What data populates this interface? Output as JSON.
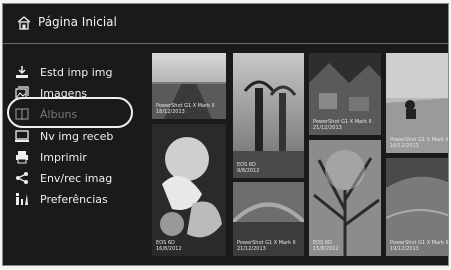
{
  "header": {
    "title": "Página Inicial",
    "icon": "home-icon"
  },
  "menu": {
    "items": [
      {
        "label": "Estd imp img",
        "icon": "download-to-printer-icon"
      },
      {
        "label": "Imagens",
        "icon": "images-icon"
      },
      {
        "label": "Álbuns",
        "icon": "album-icon",
        "selected": true
      },
      {
        "label": "Nv img receb",
        "icon": "new-images-received-icon"
      },
      {
        "label": "Imprimir",
        "icon": "printer-icon"
      },
      {
        "label": "Env/rec imag",
        "icon": "share-icon"
      },
      {
        "label": "Preferências",
        "icon": "preferences-icon"
      }
    ]
  },
  "thumbnails": [
    {
      "camera": "PowerShot G1 X Mark II",
      "date": "18/12/2013"
    },
    {
      "camera": "EOS 6D",
      "date": "9/8/2012"
    },
    {
      "camera": "PowerShot G1 X Mark II",
      "date": "21/12/2013"
    },
    {
      "camera": "PowerShot G1 X Mark II",
      "date": "16/12/2013"
    },
    {
      "camera": "EOS 6D",
      "date": "16/8/2012"
    },
    {
      "camera": "PowerShot G1 X Mark II",
      "date": "21/12/2013"
    },
    {
      "camera": "EOS 6D",
      "date": "15/8/2012"
    },
    {
      "camera": "PowerShot G1 X Mark II",
      "date": "19/12/2013"
    }
  ]
}
